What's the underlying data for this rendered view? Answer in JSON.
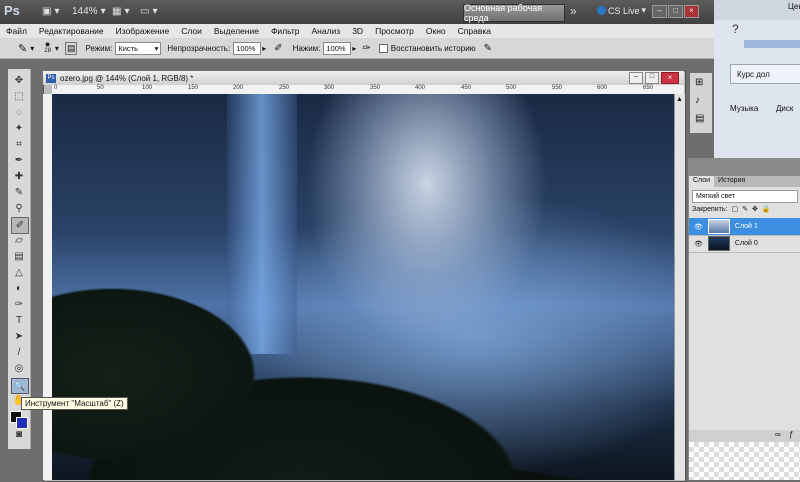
{
  "app": {
    "logo": "Ps",
    "zoom": "144%",
    "workspace": "Основная рабочая среда",
    "cs_live": "CS Live",
    "chevrons": "»"
  },
  "menu": [
    "Файл",
    "Редактирование",
    "Изображение",
    "Слои",
    "Выделение",
    "Фильтр",
    "Анализ",
    "3D",
    "Просмотр",
    "Окно",
    "Справка"
  ],
  "options": {
    "brush_size": "28",
    "mode_label": "Режим:",
    "mode_value": "Кисть",
    "opacity_label": "Непрозрачность:",
    "opacity_value": "100%",
    "pressure_label": "Нажим:",
    "pressure_value": "100%",
    "restore_label": "Восстановить историю"
  },
  "document": {
    "title": "ozero.jpg @ 144% (Слой 1, RGB/8) *"
  },
  "ruler": {
    "ticks": [
      "0",
      "50",
      "100",
      "150",
      "200",
      "250",
      "300",
      "350",
      "400",
      "450",
      "500",
      "550",
      "600",
      "650"
    ]
  },
  "tooltip": "Инструмент \"Масштаб\" (Z)",
  "layers_panel": {
    "tabs": [
      "Слои",
      "История"
    ],
    "blend_mode": "Мягкий свет",
    "lock_label": "Закрепить:",
    "layers": [
      {
        "name": "Слой 1",
        "selected": true
      },
      {
        "name": "Слой 0",
        "selected": false
      }
    ]
  },
  "browser": {
    "tab_label": "Курс дол",
    "bookmark_music": "Музыка",
    "bookmark_disk": "Диск",
    "corner_text": "Цен"
  },
  "colors": {
    "accent_selected": "#3c8fe0",
    "fg_color": "#111111",
    "bg_color": "#1f2fb8"
  }
}
